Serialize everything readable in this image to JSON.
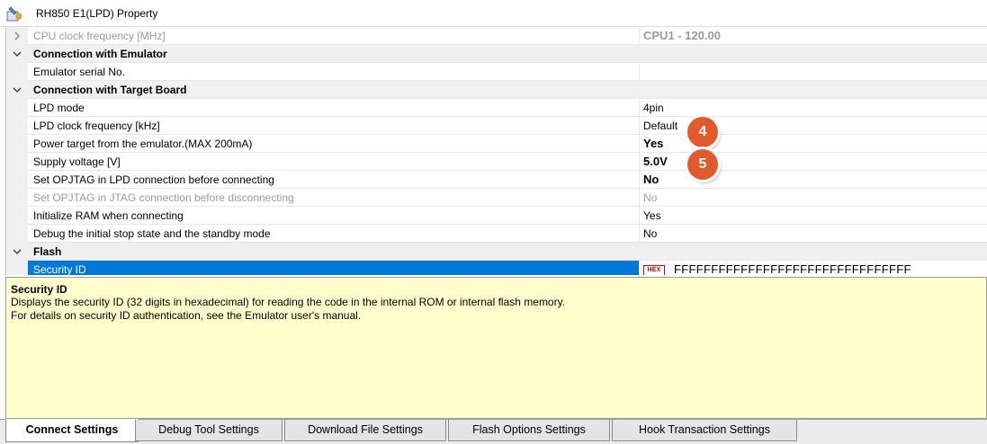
{
  "window": {
    "title": "RH850 E1(LPD) Property"
  },
  "grid": {
    "rows": [
      {
        "type": "item",
        "name": "CPU clock frequency [MHz]",
        "value": "CPU1 - 120.00",
        "state": "collapsed",
        "disabled": true
      },
      {
        "type": "category",
        "name": "Connection with Emulator"
      },
      {
        "type": "item",
        "name": "Emulator serial No.",
        "value": ""
      },
      {
        "type": "category",
        "name": "Connection with Target Board"
      },
      {
        "type": "item",
        "name": "LPD mode",
        "value": "4pin"
      },
      {
        "type": "item",
        "name": "LPD clock frequency [kHz]",
        "value": "Default"
      },
      {
        "type": "item",
        "name": "Power target from the emulator.(MAX 200mA)",
        "value": "Yes"
      },
      {
        "type": "item",
        "name": "Supply voltage [V]",
        "value": "5.0V"
      },
      {
        "type": "item",
        "name": "Set OPJTAG in LPD connection before connecting",
        "value": "No"
      },
      {
        "type": "item",
        "name": "Set OPJTAG in JTAG connection before disconnecting",
        "value": "No",
        "disabled": true
      },
      {
        "type": "item",
        "name": "Initialize RAM when connecting",
        "value": "Yes"
      },
      {
        "type": "item",
        "name": "Debug the initial stop state and the standby mode",
        "value": "No"
      },
      {
        "type": "category",
        "name": "Flash"
      },
      {
        "type": "item",
        "name": "Security ID",
        "value": "FFFFFFFFFFFFFFFFFFFFFFFFFFFFFFFF",
        "selected": true,
        "badge": "HEX"
      }
    ]
  },
  "callouts": [
    {
      "label": "4"
    },
    {
      "label": "5"
    }
  ],
  "description": {
    "title": "Security ID",
    "line1": "Displays the security ID (32 digits in hexadecimal) for reading the code in the internal ROM or internal flash memory.",
    "line2": "For details on security ID authentication, see the Emulator user's manual."
  },
  "tabs": [
    {
      "label": "Connect Settings",
      "active": true
    },
    {
      "label": "Debug Tool Settings"
    },
    {
      "label": "Download File Settings"
    },
    {
      "label": "Flash Options Settings"
    },
    {
      "label": "Hook Transaction Settings"
    }
  ],
  "colors": {
    "accent": "#0078d7",
    "callout": "#e05a2b",
    "description_bg": "#ffffcc",
    "hex_badge": "#cc0000"
  }
}
